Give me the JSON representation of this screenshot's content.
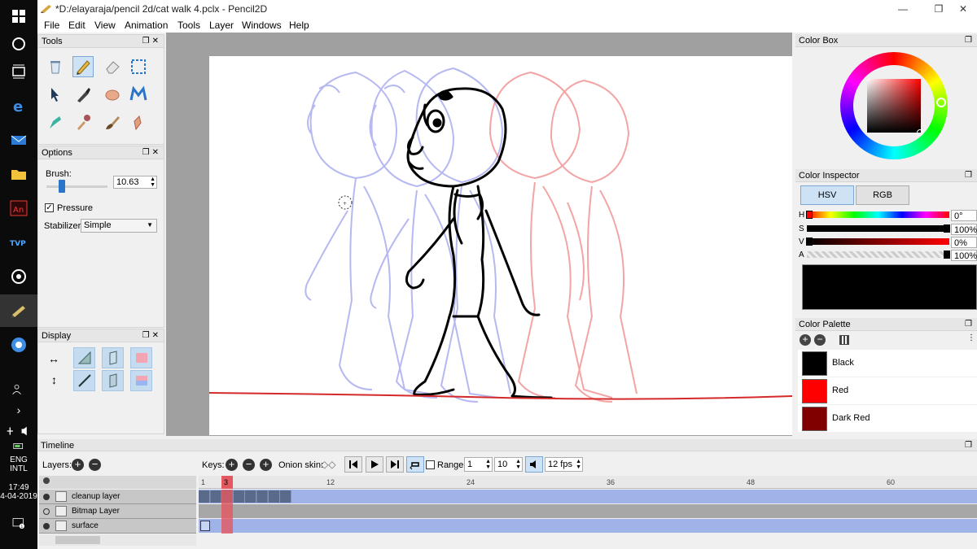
{
  "window": {
    "title": "*D:/elayaraja/pencil 2d/cat walk 4.pclx - Pencil2D",
    "minimize": "—",
    "maximize": "❐",
    "close": "✕"
  },
  "menu": [
    "File",
    "Edit",
    "View",
    "Animation",
    "Tools",
    "Layer",
    "Windows",
    "Help"
  ],
  "panels": {
    "tools": "Tools",
    "options": "Options",
    "display": "Display",
    "color_box": "Color Box",
    "color_inspector": "Color Inspector",
    "color_palette": "Color Palette",
    "timeline": "Timeline"
  },
  "options": {
    "brush_label": "Brush:",
    "brush_value": "10.63",
    "brush_level": 0.2,
    "pressure_label": "Pressure",
    "pressure_checked": true,
    "stabilizer_label": "Stabilizer",
    "stabilizer_value": "Simple"
  },
  "color_inspector": {
    "hsv_label": "HSV",
    "rgb_label": "RGB",
    "h_label": "H",
    "h_value": "0°",
    "s_label": "S",
    "s_value": "100%",
    "v_label": "V",
    "v_value": "0%",
    "a_label": "A",
    "a_value": "100%",
    "current_color": "#000000"
  },
  "palette": [
    {
      "name": "Black",
      "color": "#000000"
    },
    {
      "name": "Red",
      "color": "#ff0000"
    },
    {
      "name": "Dark Red",
      "color": "#800000"
    }
  ],
  "timeline": {
    "layers_label": "Layers:",
    "keys_label": "Keys:",
    "onion_label": "Onion skin:",
    "range_label": "Range",
    "range_start": "1",
    "range_end": "10",
    "fps": "12 fps",
    "current_frame": "3",
    "ruler": [
      "1",
      "12",
      "24",
      "36",
      "48",
      "60"
    ],
    "layers": [
      "cleanup layer",
      "Bitmap Layer",
      "surface"
    ]
  },
  "taskbar": {
    "lang": "ENG",
    "region": "INTL",
    "time": "17:49",
    "date": "4-04-2019"
  },
  "colors": {
    "accent": "#cde2f5",
    "onion_blue": "#6f74e0",
    "onion_red": "#ee7f7f",
    "playhead": "#e4585f"
  }
}
